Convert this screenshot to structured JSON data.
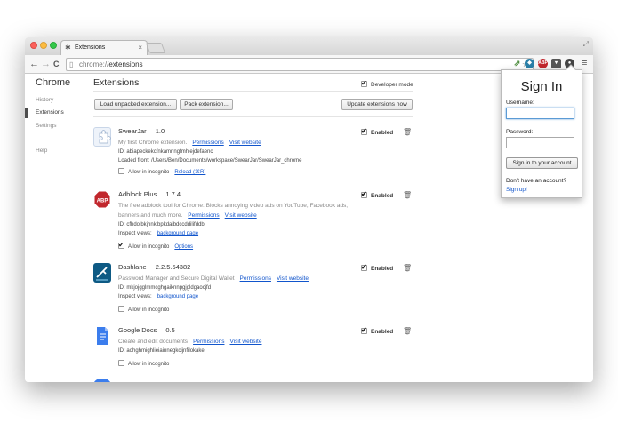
{
  "browser": {
    "tab_title": "Extensions",
    "tab_close": "×",
    "url_scheme": "chrome://",
    "url_path": "extensions",
    "back_glyph": "←",
    "forward_glyph": "→",
    "reload_glyph": "C",
    "menu_glyph": "≡",
    "star_glyph": "☆"
  },
  "sidebar": {
    "title": "Chrome",
    "items": [
      {
        "label": "History"
      },
      {
        "label": "Extensions"
      },
      {
        "label": "Settings"
      },
      {
        "label": "Help"
      }
    ]
  },
  "main": {
    "title": "Extensions",
    "developer_mode_label": "Developer mode",
    "developer_mode_checked": true,
    "buttons": {
      "load_unpacked": "Load unpacked extension...",
      "pack": "Pack extension...",
      "update": "Update extensions now"
    }
  },
  "extensions": [
    {
      "name": "SwearJar",
      "version": "1.0",
      "description": "My first Chrome extension.",
      "permissions_link": "Permissions",
      "website_link": "Visit website",
      "id_line": "ID: abiapeckekcfnkamnngfmhiejdefaenc",
      "loaded_from": "Loaded from: /Users/Ben/Documents/workspace/SwearJar/SwearJar_chrome",
      "incognito_label": "Allow in incognito",
      "incognito_checked": false,
      "extra_link": "Reload (⌘R)",
      "enabled_label": "Enabled",
      "enabled": true
    },
    {
      "name": "Adblock Plus",
      "version": "1.7.4",
      "description": "The free adblock tool for Chrome: Blocks annoying video ads on YouTube, Facebook ads, banners and much more.",
      "permissions_link": "Permissions",
      "website_link": "Visit website",
      "id_line": "ID: cfhdojbkjhnklbpkdaibdccddilifddb",
      "inspect_label": "Inspect views:",
      "inspect_link": "background page",
      "incognito_label": "Allow in incognito",
      "incognito_checked": true,
      "extra_link": "Options",
      "enabled_label": "Enabled",
      "enabled": true,
      "icon_text": "ABP"
    },
    {
      "name": "Dashlane",
      "version": "2.2.5.54382",
      "description": "Password Manager and Secure Digital Wallet",
      "permissions_link": "Permissions",
      "website_link": "Visit website",
      "id_line": "ID: mkjojgglmmcghgaiknnpgjgldgaocjfd",
      "inspect_label": "Inspect views:",
      "inspect_link": "background page",
      "incognito_label": "Allow in incognito",
      "incognito_checked": false,
      "enabled_label": "Enabled",
      "enabled": true
    },
    {
      "name": "Google Docs",
      "version": "0.5",
      "description": "Create and edit documents",
      "permissions_link": "Permissions",
      "website_link": "Visit website",
      "id_line": "ID: aohghmighlieiainnegkcijnfilokake",
      "incognito_label": "Allow in incognito",
      "incognito_checked": false,
      "enabled_label": "Enabled",
      "enabled": true
    }
  ],
  "popup": {
    "title": "Sign In",
    "username_label": "Username:",
    "username_value": "",
    "password_label": "Password:",
    "password_value": "",
    "submit_label": "Sign in to your account",
    "no_account_text": "Don't have an account?",
    "signup_link": "Sign up!"
  },
  "colors": {
    "link": "#1155cc",
    "abp_red": "#c1272d",
    "dashlane_blue": "#0e5a84",
    "docs_blue": "#3b7ded"
  }
}
